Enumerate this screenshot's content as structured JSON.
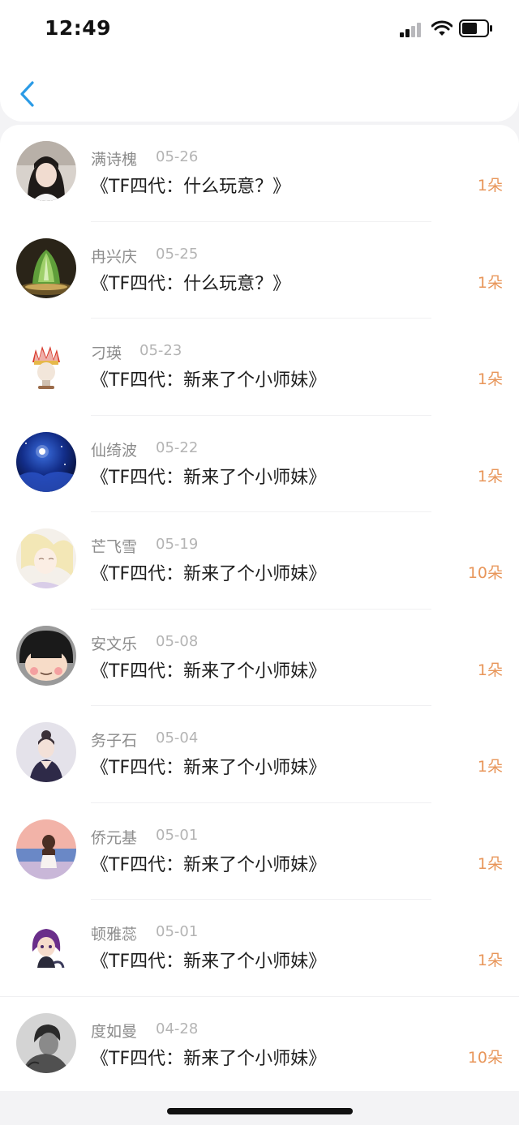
{
  "status_bar": {
    "time": "12:49"
  },
  "nav": {
    "back_icon": "chevron-left-icon",
    "accent_color": "#2b9be6"
  },
  "colors": {
    "flower_count": "#e8965a",
    "name_text": "#8c8c8c",
    "date_text": "#b4b4b4",
    "title_text": "#1d1d1d"
  },
  "records": [
    {
      "name": "满诗槐",
      "date": "05-26",
      "title": "《TF四代：什么玩意？》",
      "flowers": "1朵",
      "avatar": "avatar-photo-girl"
    },
    {
      "name": "冉兴庆",
      "date": "05-25",
      "title": "《TF四代：什么玩意？》",
      "flowers": "1朵",
      "avatar": "avatar-jade-cabbage"
    },
    {
      "name": "刁瑛",
      "date": "05-23",
      "title": "《TF四代：新来了个小师妹》",
      "flowers": "1朵",
      "avatar": "avatar-headdress"
    },
    {
      "name": "仙绮波",
      "date": "05-22",
      "title": "《TF四代：新来了个小师妹》",
      "flowers": "1朵",
      "avatar": "avatar-night-sky"
    },
    {
      "name": "芒飞雪",
      "date": "05-19",
      "title": "《TF四代：新来了个小师妹》",
      "flowers": "10朵",
      "avatar": "avatar-anime-sketch"
    },
    {
      "name": "安文乐",
      "date": "05-08",
      "title": "《TF四代：新来了个小师妹》",
      "flowers": "1朵",
      "avatar": "avatar-cartoon-girl"
    },
    {
      "name": "务子石",
      "date": "05-04",
      "title": "《TF四代：新来了个小师妹》",
      "flowers": "1朵",
      "avatar": "avatar-illustrated-woman"
    },
    {
      "name": "侨元基",
      "date": "05-01",
      "title": "《TF四代：新来了个小师妹》",
      "flowers": "1朵",
      "avatar": "avatar-beach-girl"
    },
    {
      "name": "顿雅蕊",
      "date": "05-01",
      "title": "《TF四代：新来了个小师妹》",
      "flowers": "1朵",
      "avatar": "avatar-chibi-character"
    },
    {
      "name": "度如曼",
      "date": "04-28",
      "title": "《TF四代：新来了个小师妹》",
      "flowers": "10朵",
      "avatar": "avatar-bw-photo-man"
    }
  ]
}
